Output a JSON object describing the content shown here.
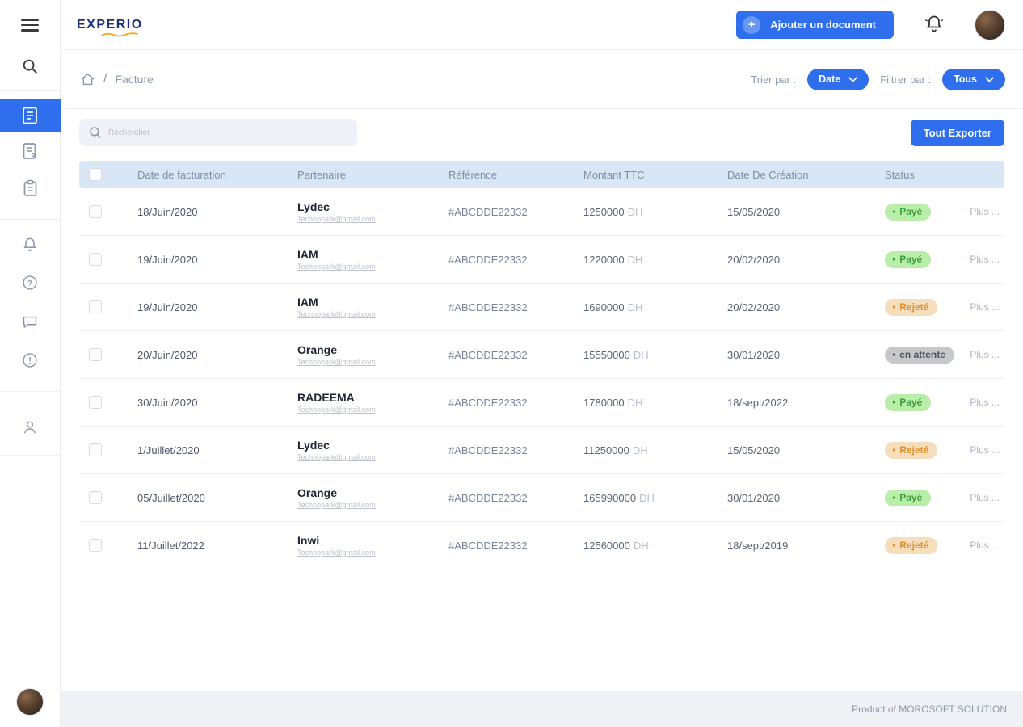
{
  "app": {
    "logo": "EXPERIO",
    "footer": "Product of MOROSOFT SOLUTION"
  },
  "header": {
    "add_button": "Ajouter un document",
    "plus_glyph": "+"
  },
  "breadcrumb": {
    "separator": "/",
    "page": "Facture"
  },
  "filters": {
    "sort_label": "Trier par :",
    "sort_value": "Date",
    "filter_label": "Filtrer par :",
    "filter_value": "Tous"
  },
  "toolbar": {
    "search_placeholder": "Rechercher",
    "export_button": "Tout Exporter"
  },
  "table": {
    "headers": [
      "Date de facturation",
      "Partenaire",
      "Référence",
      "Montant TTC",
      "Date De Création",
      "Status"
    ],
    "more_label": "Plus ...",
    "rows": [
      {
        "date": "18/Juin/2020",
        "partner": "Lydec",
        "email": "Technopark@gmail.com",
        "reference": "#ABCDDE22332",
        "amount": "1250000",
        "currency": "DH",
        "created": "15/05/2020",
        "status": "Payé",
        "status_type": "paid"
      },
      {
        "date": "19/Juin/2020",
        "partner": "IAM",
        "email": "Technopark@gmail.com",
        "reference": "#ABCDDE22332",
        "amount": "1220000",
        "currency": "DH",
        "created": "20/02/2020",
        "status": "Payé",
        "status_type": "paid"
      },
      {
        "date": "19/Juin/2020",
        "partner": "IAM",
        "email": "Technopark@gmail.com",
        "reference": "#ABCDDE22332",
        "amount": "1690000",
        "currency": "DH",
        "created": "20/02/2020",
        "status": "Rejeté",
        "status_type": "rejected"
      },
      {
        "date": "20/Juin/2020",
        "partner": "Orange",
        "email": "Technopark@gmail.com",
        "reference": "#ABCDDE22332",
        "amount": "15550000",
        "currency": "DH",
        "created": "30/01/2020",
        "status": "en attente",
        "status_type": "pending"
      },
      {
        "date": "30/Juin/2020",
        "partner": "RADEEMA",
        "email": "Technopark@gmail.com",
        "reference": "#ABCDDE22332",
        "amount": "1780000",
        "currency": "DH",
        "created": "18/sept/2022",
        "status": "Payé",
        "status_type": "paid"
      },
      {
        "date": "1/Juillet/2020",
        "partner": "Lydec",
        "email": "Technopark@gmail.com",
        "reference": "#ABCDDE22332",
        "amount": "11250000",
        "currency": "DH",
        "created": "15/05/2020",
        "status": "Rejeté",
        "status_type": "rejected"
      },
      {
        "date": "05/Juillet/2020",
        "partner": "Orange",
        "email": "Technopark@gmail.com",
        "reference": "#ABCDDE22332",
        "amount": "165990000",
        "currency": "DH",
        "created": "30/01/2020",
        "status": "Payé",
        "status_type": "paid"
      },
      {
        "date": "11/Juillet/2022",
        "partner": "Inwi",
        "email": "Technopark@gmail.com",
        "reference": "#ABCDDE22332",
        "amount": "12560000",
        "currency": "DH",
        "created": "18/sept/2019",
        "status": "Rejeté",
        "status_type": "rejected"
      }
    ]
  },
  "colors": {
    "accent_blue": "#2f6fed",
    "table_header_bg": "#d9e6f6",
    "status_paid_bg": "#b9edaa",
    "status_rejected_bg": "#f5debb",
    "status_pending_bg": "#c7c8ca",
    "logo_navy": "#1b2f7a",
    "logo_underline_orange": "#f5a623"
  }
}
